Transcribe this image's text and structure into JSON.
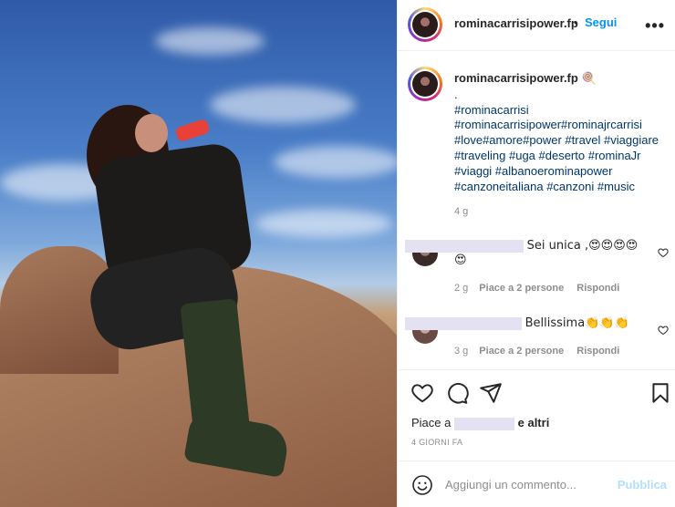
{
  "post": {
    "username": "rominacarrisipower.fp",
    "follow_label": "Segui",
    "dot": "•",
    "more_label": "•••"
  },
  "caption": {
    "username": "rominacarrisipower.fp",
    "username_emoji": "🍭",
    "first_line": ".",
    "hashtag_lines": [
      "#rominacarrisi",
      "#rominacarrisipower#rominajrcarrisi",
      "#love#amore#power #travel #viaggiare",
      "#traveling #uga #deserto #rominaJr",
      "#viaggi #albanoerominapower",
      "#canzoneitaliana #canzoni #music"
    ],
    "time": "4 g"
  },
  "comments": [
    {
      "text": "Sei unica ,😍😍😍😍",
      "text_line2": "😍",
      "time": "2 g",
      "likes_label": "Piace a 2 persone",
      "reply_label": "Rispondi"
    },
    {
      "text": "Bellissima👏👏👏",
      "time": "3 g",
      "likes_label": "Piace a 2 persone",
      "reply_label": "Rispondi"
    }
  ],
  "likes": {
    "prefix": "Piace a",
    "suffix": "e altri"
  },
  "date_label": "4 GIORNI FA",
  "add_comment": {
    "placeholder": "Aggiungi un commento...",
    "publish_label": "Pubblica"
  },
  "colors": {
    "accent": "#0095f6",
    "hashtag": "#00376b",
    "muted": "#8e8e8e",
    "publish_disabled": "#b2dffc"
  },
  "icons": [
    "heart-icon",
    "comment-icon",
    "share-icon",
    "bookmark-icon",
    "emoji-icon",
    "more-icon"
  ]
}
